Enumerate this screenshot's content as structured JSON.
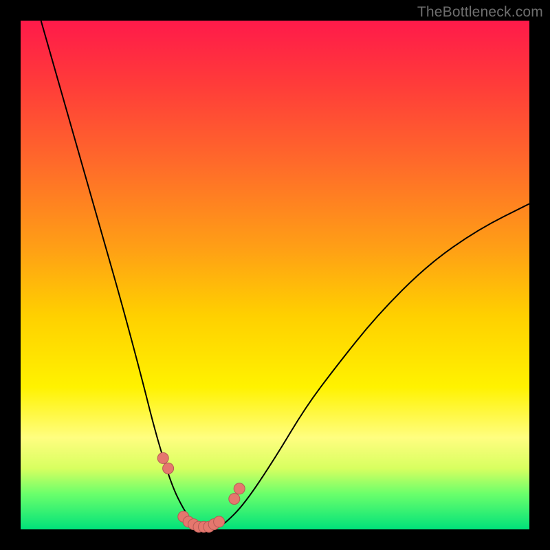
{
  "watermark": "TheBottleneck.com",
  "chart_data": {
    "type": "line",
    "title": "",
    "xlabel": "",
    "ylabel": "",
    "xlim": [
      0,
      100
    ],
    "ylim": [
      0,
      100
    ],
    "series": [
      {
        "name": "bottleneck-curve",
        "x": [
          4,
          8,
          12,
          16,
          20,
          24,
          26,
          28,
          30,
          32,
          34,
          36,
          38,
          40,
          44,
          50,
          56,
          62,
          70,
          80,
          90,
          100
        ],
        "y": [
          100,
          86,
          72,
          58,
          44,
          29,
          21,
          14,
          8,
          4,
          1,
          0,
          0,
          1,
          5,
          14,
          24,
          32,
          42,
          52,
          59,
          64
        ]
      }
    ],
    "highlight_points": {
      "name": "highlight-dots",
      "x": [
        28,
        29,
        32,
        33,
        34,
        35,
        36,
        37,
        38,
        39,
        42,
        43
      ],
      "y": [
        14,
        12,
        2.5,
        1.5,
        1,
        0.5,
        0.5,
        0.5,
        1,
        1.5,
        6,
        8
      ]
    },
    "colors": {
      "gradient_top": "#ff1a4a",
      "gradient_mid": "#fff200",
      "gradient_bottom": "#00e27a",
      "curve": "#000000",
      "dots": "#e5776e",
      "frame": "#000000",
      "watermark": "#6e6e6e"
    }
  }
}
